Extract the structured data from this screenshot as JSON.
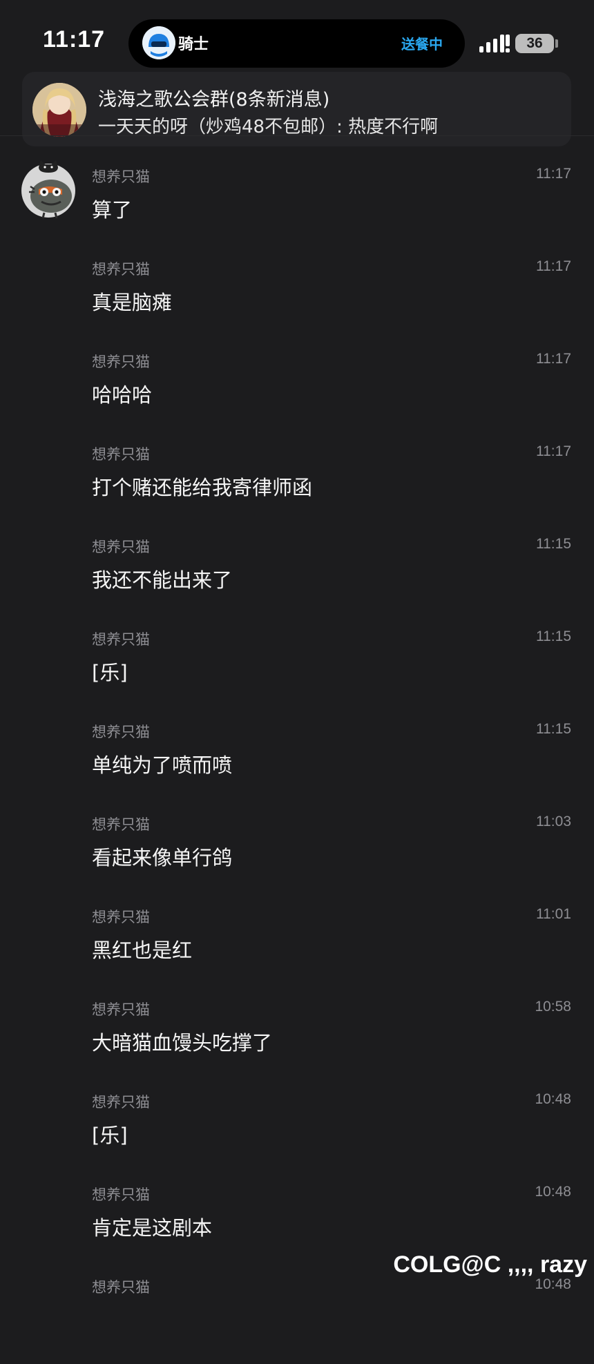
{
  "status_bar": {
    "time": "11:17",
    "island_title": "骑士",
    "island_status": "送餐中",
    "battery": "36"
  },
  "notification": {
    "title": "浅海之歌公会群(8条新消息)",
    "body": "一天天的呀（炒鸡48不包邮）: 热度不行啊"
  },
  "messages": [
    {
      "sender": "想养只猫",
      "time": "11:17",
      "text": "算了"
    },
    {
      "sender": "想养只猫",
      "time": "11:17",
      "text": "真是脑瘫"
    },
    {
      "sender": "想养只猫",
      "time": "11:17",
      "text": "哈哈哈"
    },
    {
      "sender": "想养只猫",
      "time": "11:17",
      "text": "打个赌还能给我寄律师函"
    },
    {
      "sender": "想养只猫",
      "time": "11:15",
      "text": "我还不能出来了"
    },
    {
      "sender": "想养只猫",
      "time": "11:15",
      "text": "[乐]"
    },
    {
      "sender": "想养只猫",
      "time": "11:15",
      "text": "单纯为了喷而喷"
    },
    {
      "sender": "想养只猫",
      "time": "11:03",
      "text": "看起来像单行鸽"
    },
    {
      "sender": "想养只猫",
      "time": "11:01",
      "text": "黑红也是红"
    },
    {
      "sender": "想养只猫",
      "time": "10:58",
      "text": "大暗猫血馒头吃撑了"
    },
    {
      "sender": "想养只猫",
      "time": "10:48",
      "text": "[乐]"
    },
    {
      "sender": "想养只猫",
      "time": "10:48",
      "text": "肯定是这剧本"
    },
    {
      "sender": "想养只猫",
      "time": "10:48",
      "text": ""
    }
  ],
  "watermark": "COLG@C ,,,, razy",
  "colors": {
    "background": "#1c1c1e",
    "secondary_text": "#8e8e93",
    "accent": "#2aa8f0"
  }
}
